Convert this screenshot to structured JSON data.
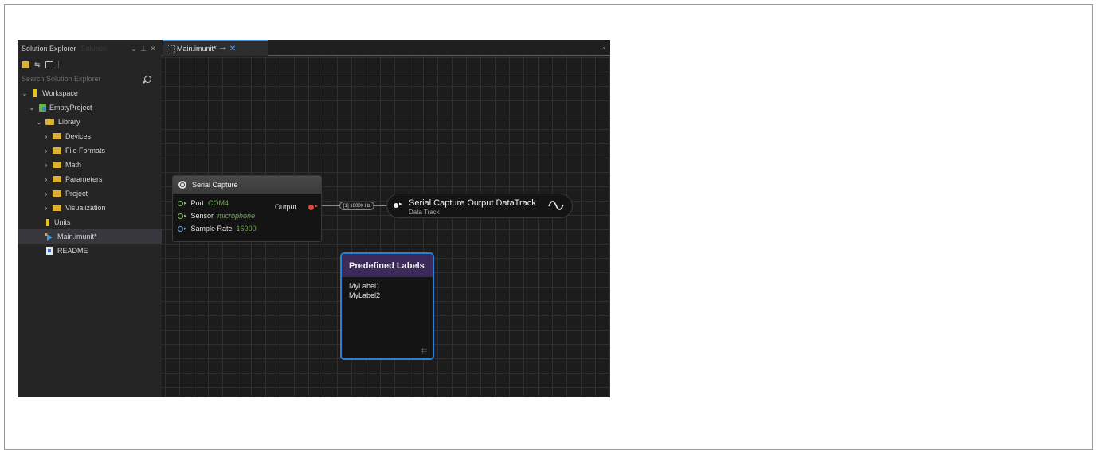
{
  "sidebar": {
    "title": "Solution Explorer",
    "title_faded": "Solution",
    "search_placeholder": "Search Solution Explorer",
    "items": [
      {
        "label": "Workspace"
      },
      {
        "label": "EmptyProject"
      },
      {
        "label": "Library"
      },
      {
        "label": "Devices"
      },
      {
        "label": "File Formats"
      },
      {
        "label": "Math"
      },
      {
        "label": "Parameters"
      },
      {
        "label": "Project"
      },
      {
        "label": "Visualization"
      },
      {
        "label": "Units"
      },
      {
        "label": "Main.imunit*"
      },
      {
        "label": "README"
      }
    ]
  },
  "editor": {
    "tab_label": "Main.imunit*"
  },
  "nodes": {
    "serial_capture": {
      "title": "Serial Capture",
      "port_label": "Port",
      "port_value": "COM4",
      "sensor_label": "Sensor",
      "sensor_value": "microphone",
      "rate_label": "Sample Rate",
      "rate_value": "16000",
      "output_label": "Output"
    },
    "connection": {
      "badge": "[1] 16000 Hz"
    },
    "data_track": {
      "title": "Serial Capture Output DataTrack",
      "subtitle": "Data Track"
    },
    "predefined_labels": {
      "title": "Predefined Labels",
      "labels": [
        "MyLabel1",
        "MyLabel2"
      ]
    }
  },
  "colors": {
    "accent_blue": "#2f7fd0",
    "value_green": "#6ab04c",
    "output_red": "#e04a3a",
    "labels_header": "#3c2b5a"
  }
}
